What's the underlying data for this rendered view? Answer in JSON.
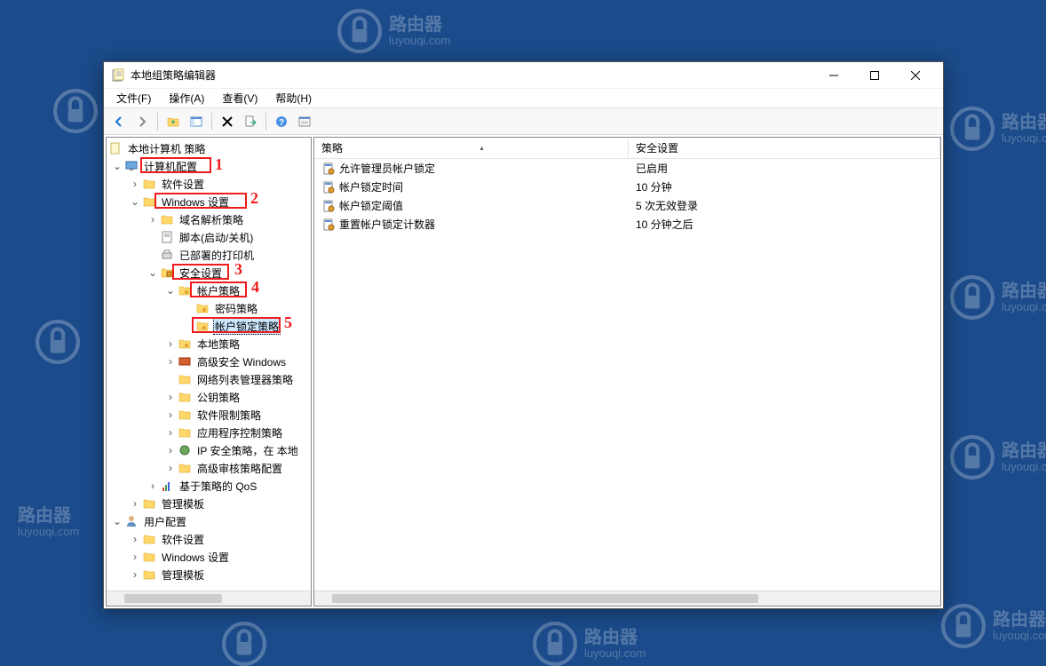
{
  "watermark": {
    "name": "路由器",
    "url": "luyouqi.com"
  },
  "window": {
    "title": "本地组策略编辑器"
  },
  "menubar": [
    "文件(F)",
    "操作(A)",
    "查看(V)",
    "帮助(H)"
  ],
  "annotations": [
    "1",
    "2",
    "3",
    "4",
    "5"
  ],
  "tree": {
    "root": "本地计算机 策略",
    "computer_config": "计算机配置",
    "cc_software": "软件设置",
    "cc_windows": "Windows 设置",
    "dns_policy": "域名解析策略",
    "scripts": "脚本(启动/关机)",
    "printers": "已部署的打印机",
    "security": "安全设置",
    "account_policy": "帐户策略",
    "password_policy": "密码策略",
    "lockout_policy": "帐户锁定策略",
    "local_policy": "本地策略",
    "adv_windows": "高级安全 Windows",
    "net_list": "网络列表管理器策略",
    "public_key": "公钥策略",
    "software_restrict": "软件限制策略",
    "app_control": "应用程序控制策略",
    "ip_sec": "IP 安全策略，在 本地",
    "adv_audit": "高级审核策略配置",
    "qos": "基于策略的 QoS",
    "admin_templates": "管理模板",
    "user_config": "用户配置",
    "uc_software": "软件设置",
    "uc_windows": "Windows 设置",
    "uc_admin": "管理模板"
  },
  "list": {
    "col_policy": "策略",
    "col_security": "安全设置",
    "rows": [
      {
        "policy": "允许管理员帐户锁定",
        "setting": "已启用"
      },
      {
        "policy": "帐户锁定时间",
        "setting": "10 分钟"
      },
      {
        "policy": "帐户锁定阈值",
        "setting": "5 次无效登录"
      },
      {
        "policy": "重置帐户锁定计数器",
        "setting": "10 分钟之后"
      }
    ]
  }
}
